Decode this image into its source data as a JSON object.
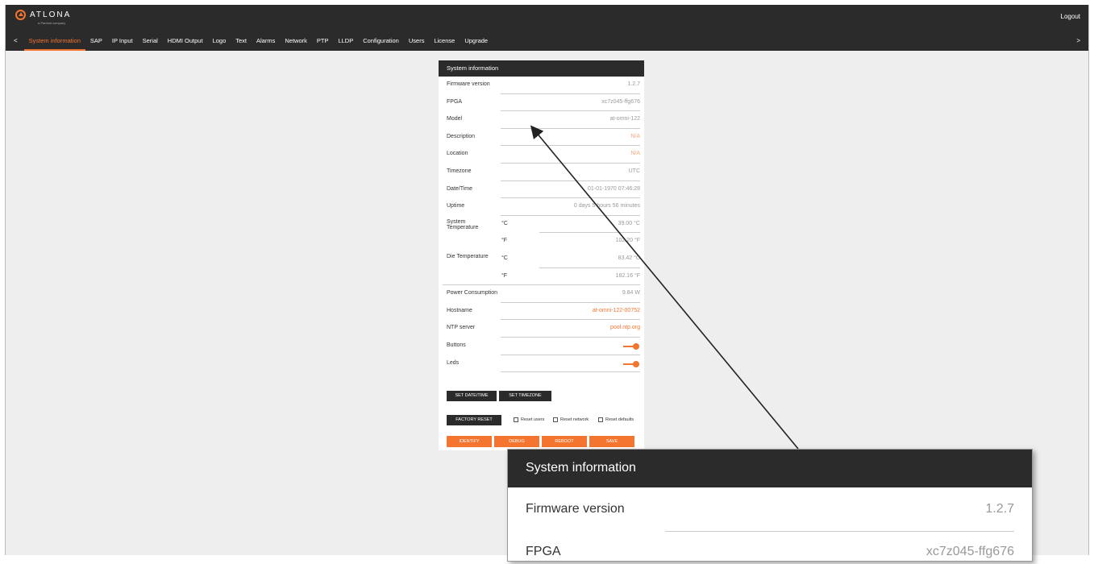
{
  "header": {
    "logo_text": "ATLONA",
    "logo_subtext": "a Panduit company",
    "logout_label": "Logout"
  },
  "nav": {
    "left_arrow": "<",
    "right_arrow": ">",
    "items": [
      {
        "label": "System information",
        "active": true
      },
      {
        "label": "SAP"
      },
      {
        "label": "IP Input"
      },
      {
        "label": "Serial"
      },
      {
        "label": "HDMI Output"
      },
      {
        "label": "Logo"
      },
      {
        "label": "Text"
      },
      {
        "label": "Alarms"
      },
      {
        "label": "Network"
      },
      {
        "label": "PTP"
      },
      {
        "label": "LLDP"
      },
      {
        "label": "Configuration"
      },
      {
        "label": "Users"
      },
      {
        "label": "License"
      },
      {
        "label": "Upgrade"
      }
    ]
  },
  "panel": {
    "title": "System information",
    "firmware_label": "Firmware version",
    "firmware_value": "1.2.7",
    "fpga_label": "FPGA",
    "fpga_value": "xc7z045-ffg676",
    "model_label": "Model",
    "model_value": "at-omni-122",
    "description_label": "Description",
    "description_value": "N/A",
    "location_label": "Location",
    "location_value": "N/A",
    "timezone_label": "Timezone",
    "timezone_value": "UTC",
    "datetime_label": "Date/Time",
    "datetime_value": "01-01-1970 07:46:28",
    "uptime_label": "Uptime",
    "uptime_value": "0 days 5 hours 56 minutes",
    "sys_temp_label": "System Temperature",
    "sys_temp_c_unit": "°C",
    "sys_temp_c_value": "39.00 °C",
    "sys_temp_f_unit": "°F",
    "sys_temp_f_value": "102.20 °F",
    "die_temp_label": "Die Temperature",
    "die_temp_c_unit": "°C",
    "die_temp_c_value": "83.42 °C",
    "die_temp_f_unit": "°F",
    "die_temp_f_value": "182.16 °F",
    "power_label": "Power Consumption",
    "power_value": "9.84 W",
    "hostname_label": "Hostname",
    "hostname_value": "at-omni-122-00752",
    "ntp_label": "NTP server",
    "ntp_value": "pool.ntp.org",
    "buttons_label": "Buttons",
    "buttons_on": true,
    "leds_label": "Leds",
    "leds_on": true,
    "set_datetime_btn": "SET DATE/TIME",
    "set_timezone_btn": "SET TIMEZONE",
    "factory_reset_btn": "FACTORY RESET",
    "reset_users_label": "Reset users",
    "reset_network_label": "Reset network",
    "reset_defaults_label": "Reset defaults",
    "identify_btn": "IDENTIFY",
    "debug_btn": "DEBUG",
    "reboot_btn": "REBOOT",
    "save_btn": "SAVE"
  },
  "zoom": {
    "title": "System information",
    "firmware_label": "Firmware version",
    "firmware_value": "1.2.7",
    "fpga_label": "FPGA",
    "fpga_value": "xc7z045-ffg676"
  },
  "colors": {
    "accent": "#f47530",
    "header_bg": "#2b2b2b",
    "page_bg": "#eeeeee"
  }
}
